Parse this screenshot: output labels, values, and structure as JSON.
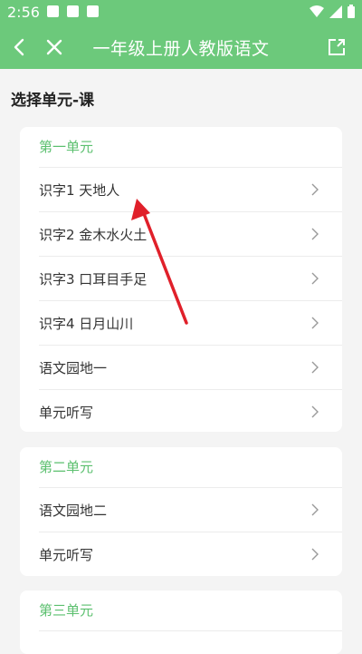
{
  "status_bar": {
    "time": "2:56"
  },
  "appbar": {
    "title": "一年级上册人教版语文"
  },
  "section_title": "选择单元-课",
  "units": [
    {
      "title": "第一单元",
      "lessons": [
        "识字1 天地人",
        "识字2 金木水火土",
        "识字3 口耳目手足",
        "识字4 日月山川",
        "语文园地一",
        "单元听写"
      ]
    },
    {
      "title": "第二单元",
      "lessons": [
        "语文园地二",
        "单元听写"
      ]
    },
    {
      "title": "第三单元",
      "lessons": []
    }
  ],
  "colors": {
    "accent": "#6cc97b",
    "unit_title": "#5cc06f",
    "annotation_arrow": "#e0202a"
  }
}
